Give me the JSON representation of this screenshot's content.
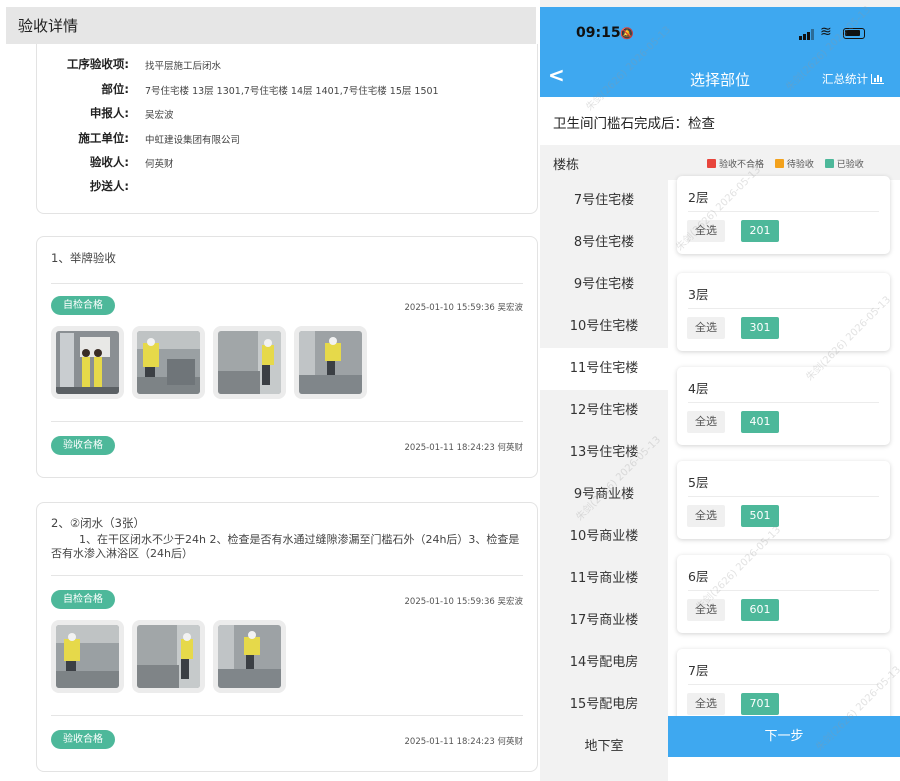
{
  "left": {
    "header_title": "验收详情",
    "info": [
      {
        "label": "工序验收项:",
        "value": "找平层施工后闭水"
      },
      {
        "label": "部位:",
        "value": "7号住宅楼 13层 1301,7号住宅楼 14层 1401,7号住宅楼 15层 1501"
      },
      {
        "label": "申报人:",
        "value": "吴宏波"
      },
      {
        "label": "施工单位:",
        "value": "中虹建设集团有限公司"
      },
      {
        "label": "验收人:",
        "value": "何英财"
      },
      {
        "label": "抄送人:",
        "value": ""
      }
    ],
    "sections": [
      {
        "title": "1、举牌验收",
        "self_badge": "自检合格",
        "self_stamp": "2025-01-10 15:59:36 吴宏波",
        "accept_badge": "验收合格",
        "accept_stamp": "2025-01-11 18:24:23 何英财"
      },
      {
        "title": "2、②闭水（3张）",
        "description": "1、在干区闭水不少于24h 2、检查是否有水通过缝隙渗漏至门槛石外（24h后）3、检查是否有水渗入淋浴区（24h后）",
        "self_badge": "自检合格",
        "self_stamp": "2025-01-10 15:59:36 吴宏波",
        "accept_badge": "验收合格",
        "accept_stamp": "2025-01-11 18:24:23 何英财"
      }
    ]
  },
  "right": {
    "status": {
      "time": "09:15"
    },
    "nav": {
      "back": "<",
      "title": "选择部位",
      "summary": "汇总统计"
    },
    "subtitle": "卫生间门槛石完成后：检查",
    "building_header": "楼栋",
    "legend": [
      {
        "label": "验收不合格",
        "color": "#e8453c"
      },
      {
        "label": "待验收",
        "color": "#f3a21d"
      },
      {
        "label": "已验收",
        "color": "#4db89a"
      }
    ],
    "buildings": [
      "7号住宅楼",
      "8号住宅楼",
      "9号住宅楼",
      "10号住宅楼",
      "11号住宅楼",
      "12号住宅楼",
      "13号住宅楼",
      "9号商业楼",
      "10号商业楼",
      "11号商业楼",
      "17号商业楼",
      "14号配电房",
      "15号配电房",
      "地下室"
    ],
    "selected_building_index": 4,
    "floors": [
      {
        "floor": "2层",
        "select_all": "全选",
        "room": "201"
      },
      {
        "floor": "3层",
        "select_all": "全选",
        "room": "301"
      },
      {
        "floor": "4层",
        "select_all": "全选",
        "room": "401"
      },
      {
        "floor": "5层",
        "select_all": "全选",
        "room": "501"
      },
      {
        "floor": "6层",
        "select_all": "全选",
        "room": "601"
      },
      {
        "floor": "7层",
        "select_all": "全选",
        "room": "701"
      }
    ],
    "next_button": "下一步",
    "watermark": "朱剑(2626) 2026-05-13"
  }
}
